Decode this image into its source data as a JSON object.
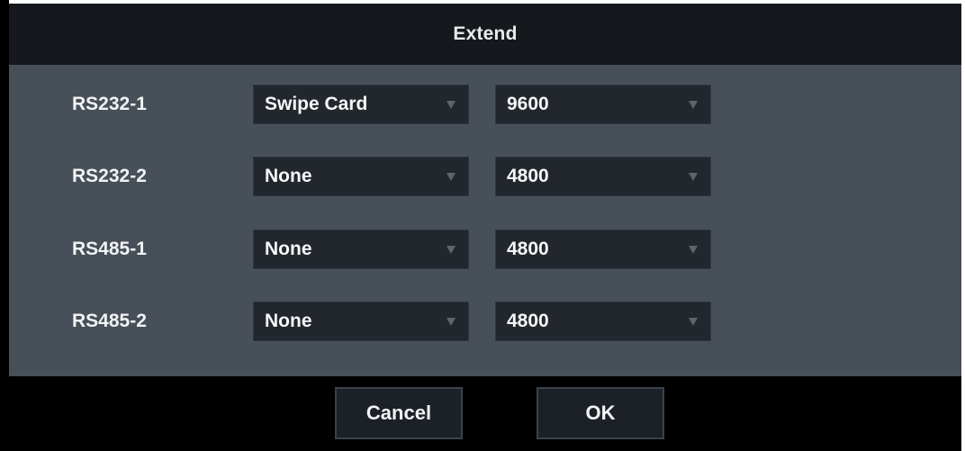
{
  "dialog": {
    "title": "Extend"
  },
  "ports": [
    {
      "label": "RS232-1",
      "mode": "Swipe Card",
      "baud": "9600"
    },
    {
      "label": "RS232-2",
      "mode": "None",
      "baud": "4800"
    },
    {
      "label": "RS485-1",
      "mode": "None",
      "baud": "4800"
    },
    {
      "label": "RS485-2",
      "mode": "None",
      "baud": "4800"
    }
  ],
  "buttons": {
    "cancel_label": "Cancel",
    "ok_label": "OK"
  },
  "icons": {
    "dropdown": "caret-down-icon"
  },
  "colors": {
    "panel": "#474f58",
    "titlebar": "#15191e",
    "select_bg": "#22272d",
    "footer": "#000000",
    "text": "#f2f3f4"
  }
}
